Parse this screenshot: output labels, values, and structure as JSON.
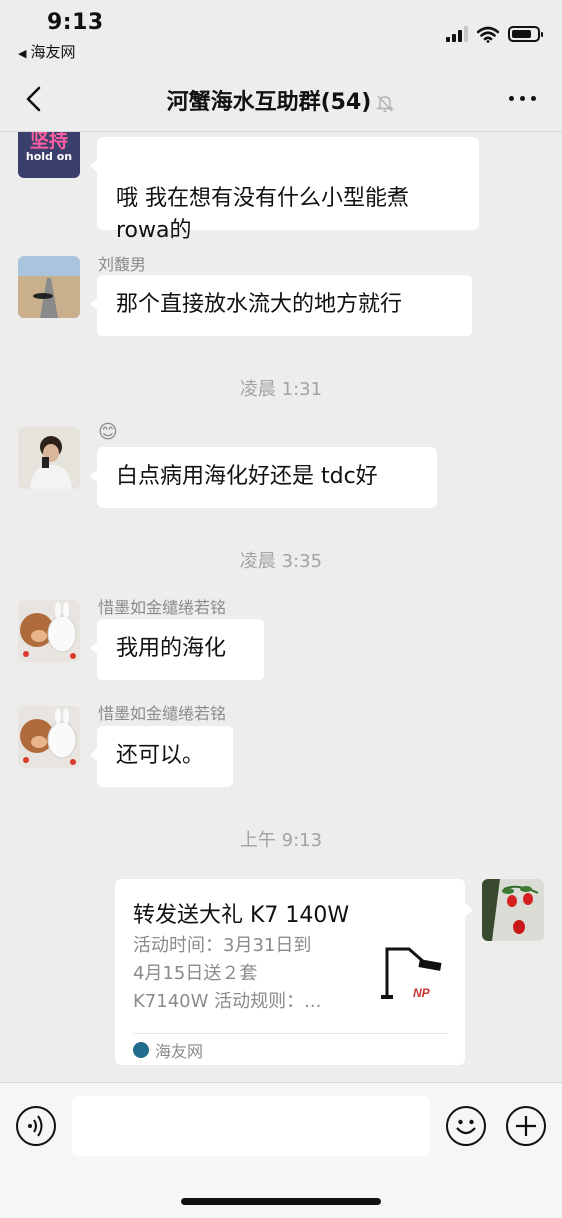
{
  "status_bar": {
    "time": "9:13",
    "back_app": "海友网",
    "signal_bars": 3,
    "battery_level": 0.8
  },
  "nav": {
    "title": "河蟹海水互助群(54)",
    "icons": [
      "chevron-left-icon",
      "bell-muted-icon",
      "more-icon"
    ]
  },
  "messages": [
    {
      "sender": "",
      "text": "哦 我在想有没有什么小型能煮\nrowa的",
      "avatar_text": "坚持",
      "avatar_sub": "hold on"
    },
    {
      "sender": "刘馥男",
      "text": "那个直接放水流大的地方就行"
    },
    {
      "sender": "😊",
      "text": "白点病用海化好还是 tdc好"
    },
    {
      "sender": "惜墨如金缱绻若铭",
      "text": "我用的海化"
    },
    {
      "sender": "惜墨如金缱绻若铭",
      "text": "还可以。"
    }
  ],
  "time_dividers": [
    "凌晨 1:31",
    "凌晨 3:35",
    "上午 9:13"
  ],
  "share_card": {
    "title": "转发送大礼 K7 140W",
    "description": "活动时间：3月31日到\n4月15日送２套\nK7140W 活动规则：...",
    "source": "海友网",
    "thumb_text": "NP"
  },
  "input_bar": {
    "icons": [
      "voice-icon",
      "emoji-icon",
      "plus-icon"
    ]
  },
  "colors": {
    "background": "#ededed",
    "bubble": "#ffffff",
    "secondary_text": "#8b8b8b",
    "timestamp": "#a3a3a3"
  }
}
